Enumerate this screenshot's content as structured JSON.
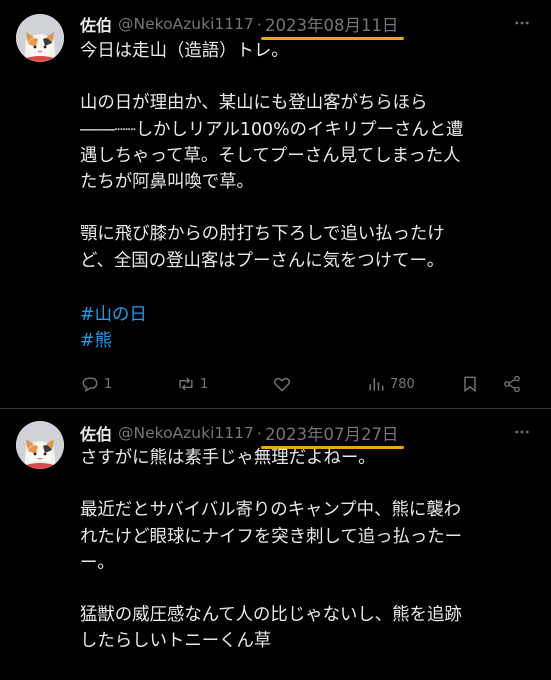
{
  "tweets": [
    {
      "author_name": "佐伯",
      "handle": "@NekoAzuki1117",
      "separator": "·",
      "date": "2023年08月11日",
      "lines": [
        "今日は走山（造語）トレ。",
        "",
        "山の日が理由か、某山にも登山客がちらほら",
        "――┈┈しかしリアル100%のイキリプーさんと遭",
        "遇しちゃって草。そしてプーさん見てしまった人",
        "たちが阿鼻叫喚で草。",
        "",
        "顎に飛び膝からの肘打ち下ろしで追い払ったけ",
        "ど、全国の登山客はプーさんに気をつけてー。",
        ""
      ],
      "hashtags": [
        "#山の日",
        "#熊"
      ],
      "actions": {
        "reply_count": "1",
        "retweet_count": "1",
        "like_count": "",
        "view_count": "780"
      },
      "icons": [
        "reply-icon",
        "retweet-icon",
        "like-icon",
        "views-icon",
        "bookmark-icon",
        "share-icon",
        "more-icon"
      ]
    },
    {
      "author_name": "佐伯",
      "handle": "@NekoAzuki1117",
      "separator": "·",
      "date": "2023年07月27日",
      "lines": [
        "さすがに熊は素手じゃ無理だよねー。",
        "",
        "最近だとサバイバル寄りのキャンプ中、熊に襲わ",
        "れたけど眼球にナイフを突き刺して追っ払ったー",
        "ー。",
        "",
        "猛獣の威圧感なんて人の比じゃないし、熊を追跡",
        "したらしいトニーくん草"
      ]
    }
  ],
  "colors": {
    "background": "#000000",
    "text": "#e7e9ea",
    "muted": "#71767b",
    "link": "#1d9bf0",
    "highlight_underline": "#f0a800",
    "divider": "#2f3336"
  }
}
